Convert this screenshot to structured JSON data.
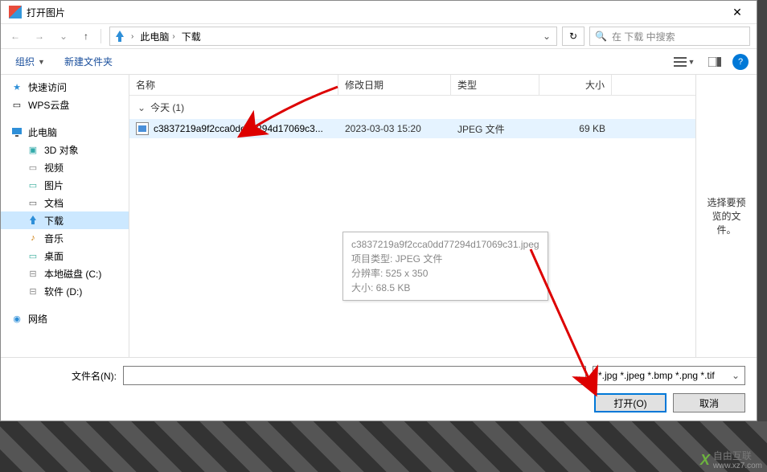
{
  "dialog": {
    "title": "打开图片",
    "close": "✕"
  },
  "nav": {
    "back": "←",
    "forward": "→",
    "recent_dd": "⌄",
    "up": "↑",
    "refresh": "↻",
    "path": {
      "seg1": "此电脑",
      "seg2": "下载"
    },
    "search_placeholder": "在 下载 中搜索",
    "search_icon": "🔍"
  },
  "toolbar": {
    "organize": "组织",
    "newfolder": "新建文件夹",
    "help": "?"
  },
  "sidebar": {
    "quick": "快速访问",
    "wps": "WPS云盘",
    "thispc": "此电脑",
    "obj3d": "3D 对象",
    "video": "视频",
    "pictures": "图片",
    "docs": "文档",
    "downloads": "下载",
    "music": "音乐",
    "desktop": "桌面",
    "localc": "本地磁盘 (C:)",
    "softd": "软件 (D:)",
    "network": "网络"
  },
  "columns": {
    "name": "名称",
    "date": "修改日期",
    "type": "类型",
    "size": "大小"
  },
  "group": {
    "today": "今天 (1)"
  },
  "file": {
    "name": "c3837219a9f2cca0dd77294d17069c3...",
    "date": "2023-03-03 15:20",
    "type": "JPEG 文件",
    "size": "69 KB"
  },
  "tooltip": {
    "fname": "c3837219a9f2cca0dd77294d17069c31.jpeg",
    "itemtype": "项目类型: JPEG 文件",
    "res": "分辨率: 525 x 350",
    "fsize": "大小: 68.5 KB"
  },
  "preview": {
    "text": "选择要预览的文件。"
  },
  "footer": {
    "fn_label": "文件名(N):",
    "filter": "*.jpg *.jpeg *.bmp *.png *.tif",
    "open": "打开(O)",
    "cancel": "取消"
  },
  "watermark": {
    "brand": "自由互联",
    "url": "www.xz7.com"
  }
}
